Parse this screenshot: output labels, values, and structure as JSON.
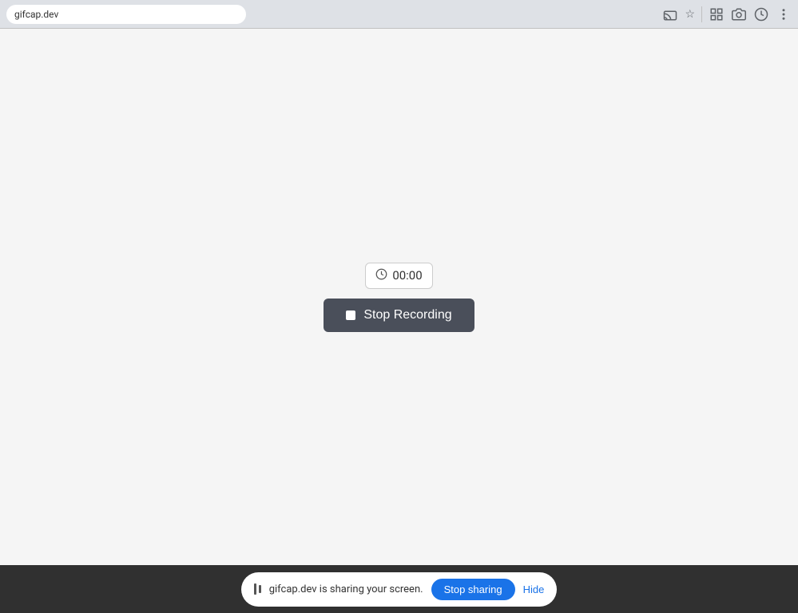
{
  "browser": {
    "url": "gifcap.dev",
    "icons": {
      "cast": "⬒",
      "star": "☆",
      "extensions": "⊞",
      "screenshot": "📷",
      "history": "🕐",
      "menu": "⋮"
    }
  },
  "main": {
    "timer": {
      "time": "00:00",
      "icon": "🕐"
    },
    "stop_button": {
      "label": "Stop Recording",
      "icon": "■"
    }
  },
  "screen_sharing_bar": {
    "indicator_text": "gifcap.dev is sharing your screen.",
    "stop_sharing_label": "Stop sharing",
    "hide_label": "Hide"
  }
}
